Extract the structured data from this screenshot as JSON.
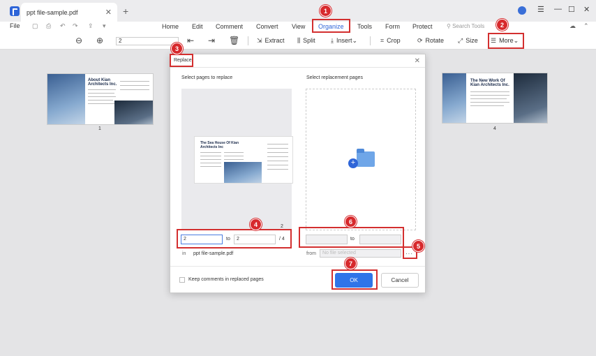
{
  "titlebar": {
    "tab_title": "ppt file-sample.pdf",
    "tab_close": "✕",
    "tab_add": "+",
    "minimize": "—",
    "maximize": "☐",
    "close": "✕"
  },
  "menubar": {
    "file": "File",
    "items": [
      "Home",
      "Edit",
      "Comment",
      "Convert",
      "View",
      "Organize",
      "Tools",
      "Form",
      "Protect"
    ],
    "active": "Organize",
    "search_placeholder": "Search Tools"
  },
  "toolbar": {
    "page_value": "2",
    "extract": "Extract",
    "split": "Split",
    "insert": "Insert",
    "crop": "Crop",
    "rotate": "Rotate",
    "size": "Size",
    "more": "More"
  },
  "pages": {
    "left_number": "1",
    "left_title": "About Kian Architects Inc.",
    "right_number": "4",
    "right_title": "The New Work Of Kian Architects Inc."
  },
  "dialog": {
    "title": "Replace",
    "close": "✕",
    "left_label": "Select pages to replace",
    "right_label": "Select replacement pages",
    "preview_title": "The Sea House Of Kian Architects Inc",
    "preview_page_number": "2",
    "from_page": "2",
    "to_label": "to",
    "to_page": "2",
    "total": "/ 4",
    "in_label": "in",
    "file_name": "ppt file-sample.pdf",
    "repl_to_label": "to",
    "from_label": "from",
    "no_file_placeholder": "No file selected",
    "browse": "···",
    "keep_comments": "Keep comments in replaced pages",
    "ok": "OK",
    "cancel": "Cancel"
  },
  "annotations": [
    "1",
    "2",
    "3",
    "4",
    "5",
    "6",
    "7"
  ],
  "colors": {
    "accent": "#2e65d8",
    "ok_button": "#2f74e8",
    "annotation_red": "#d7292c"
  }
}
